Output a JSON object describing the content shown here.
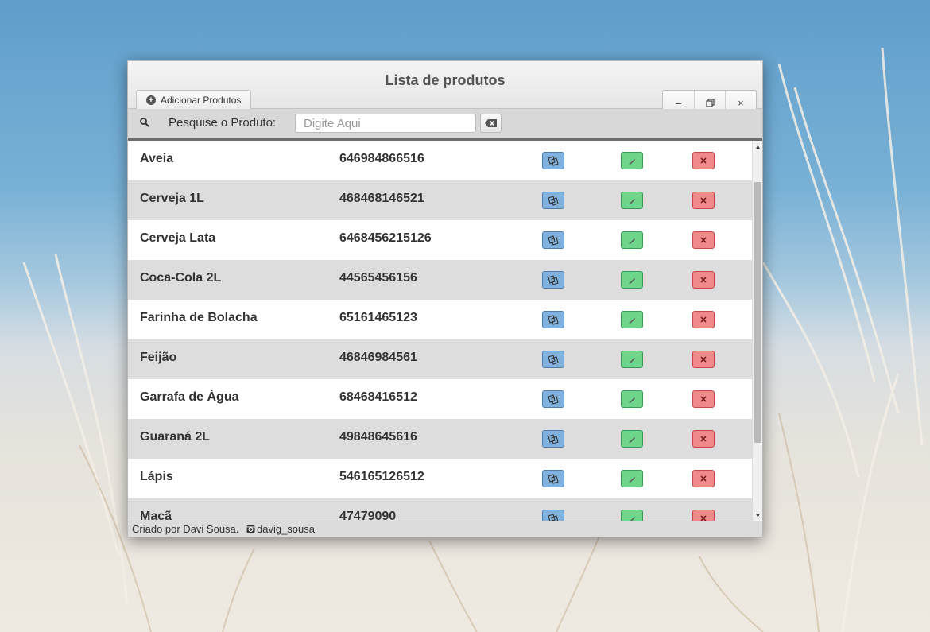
{
  "window": {
    "title": "Lista de produtos"
  },
  "toolbar": {
    "add_label": "Adicionar Produtos",
    "minimize": "–",
    "maximize": "⧉",
    "close": "×"
  },
  "search": {
    "label": "Pesquise o Produto:",
    "placeholder": "Digite Aqui",
    "value": ""
  },
  "products": [
    {
      "name": "Aveia",
      "code": "646984866516"
    },
    {
      "name": "Cerveja 1L",
      "code": "468468146521"
    },
    {
      "name": "Cerveja Lata",
      "code": "6468456215126"
    },
    {
      "name": "Coca-Cola 2L",
      "code": "44565456156"
    },
    {
      "name": "Farinha de Bolacha",
      "code": "65161465123"
    },
    {
      "name": "Feijão",
      "code": "46846984561"
    },
    {
      "name": "Garrafa de Água",
      "code": "68468416512"
    },
    {
      "name": "Guaraná 2L",
      "code": "49848645616"
    },
    {
      "name": "Lápis",
      "code": "546165126512"
    },
    {
      "name": "Macã",
      "code": "47479090"
    }
  ],
  "row_actions": {
    "view_icon": "copy-icon",
    "edit_icon": "pencil-icon",
    "delete_icon": "close-icon"
  },
  "footer": {
    "credit": "Criado por Davi Sousa.",
    "instagram": "davig_sousa"
  },
  "colors": {
    "view": "#7fb2de",
    "edit": "#6fd58a",
    "delete": "#f08a8a"
  }
}
